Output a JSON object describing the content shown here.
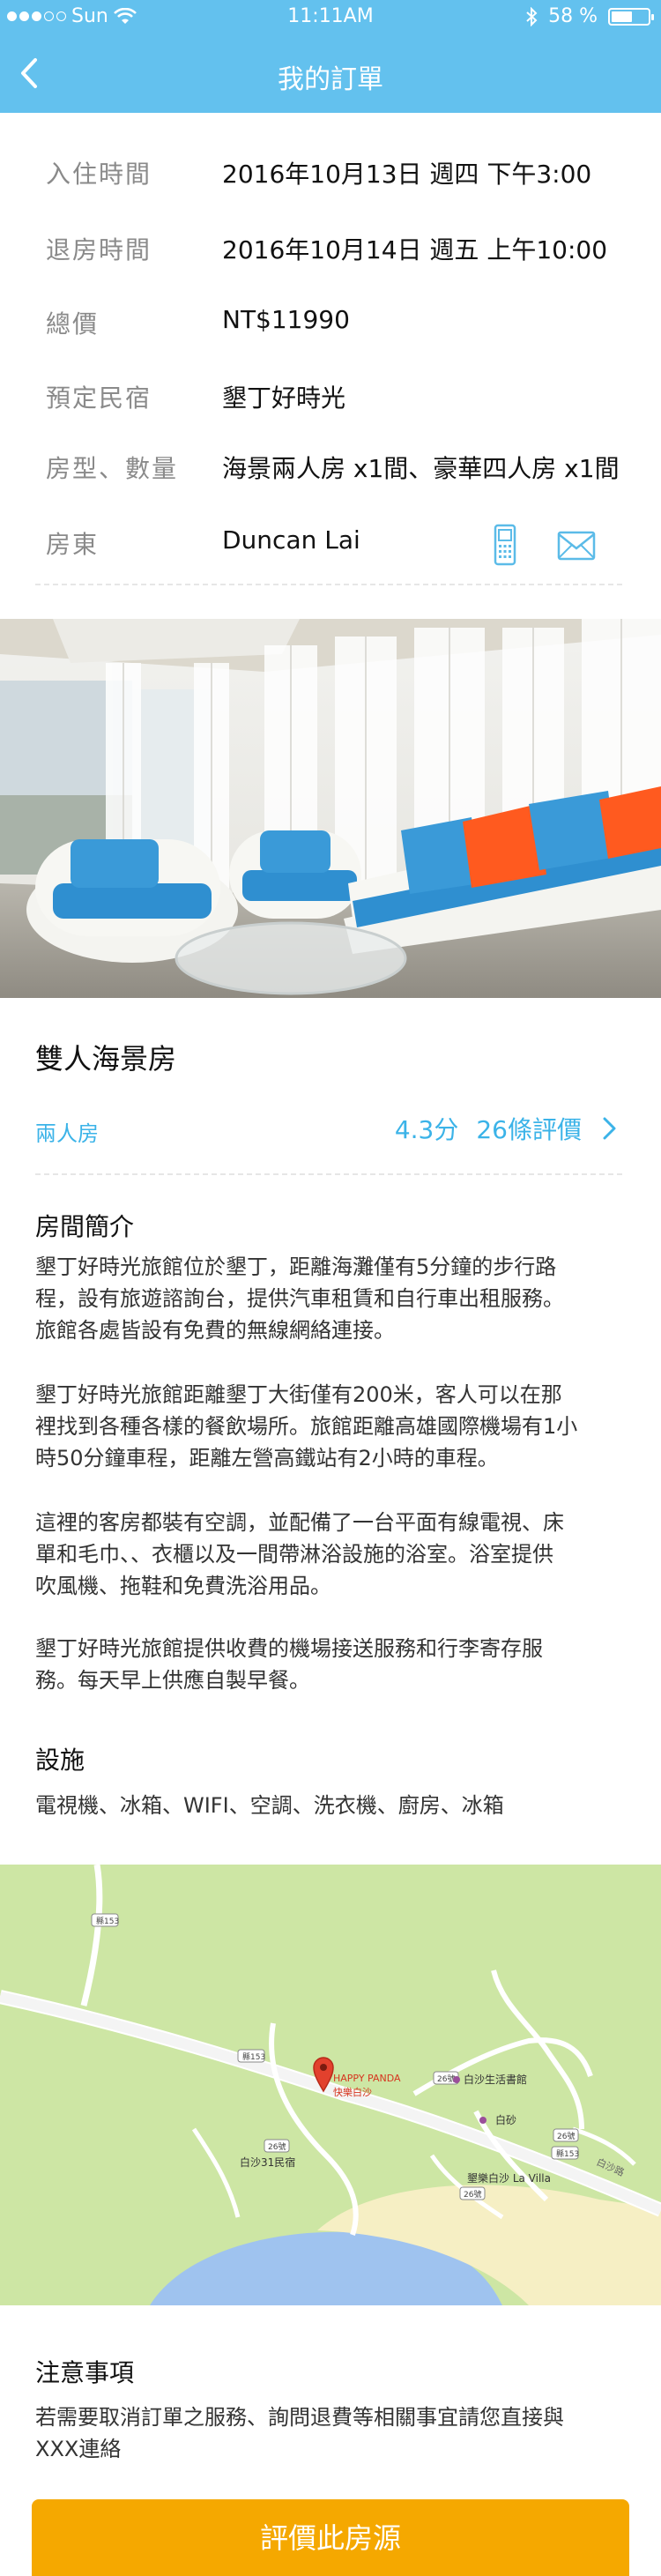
{
  "status_bar": {
    "carrier": "Sun",
    "time": "11:11AM",
    "battery": "58 %",
    "battery_level": 0.58
  },
  "nav": {
    "title": "我的訂單"
  },
  "order": {
    "rows": [
      {
        "label": "入住時間",
        "value": "2016年10月13日 週四 下午3:00"
      },
      {
        "label": "退房時間",
        "value": "2016年10月14日 週五 上午10:00"
      },
      {
        "label": "總價",
        "value": "NT$11990"
      },
      {
        "label": "預定民宿",
        "value": "墾丁好時光"
      },
      {
        "label": "房型、數量",
        "value": "海景兩人房 x1間、豪華四人房 x1間"
      },
      {
        "label": "房東",
        "value": "Duncan Lai"
      }
    ]
  },
  "room": {
    "title": "雙人海景房",
    "type": "兩人房",
    "score": "4.3分",
    "reviews": "26條評價"
  },
  "intro": {
    "title": "房間簡介",
    "paragraphs": [
      [
        "墾丁好時光旅館位於墾丁，距離海灘僅有5分鐘的步行路",
        "程，設有旅遊諮詢台，提供汽車租賃和自行車出租服務。",
        "旅館各處皆設有免費的無線網絡連接。"
      ],
      [
        "墾丁好時光旅館距離墾丁大街僅有200米，客人可以在那",
        "裡找到各種各樣的餐飲場所。旅館距離高雄國際機場有1小",
        "時50分鐘車程，距離左營高鐵站有2小時的車程。"
      ],
      [
        "這裡的客房都裝有空調，並配備了一台平面有線電視、床",
        "單和毛巾、、衣櫃以及一間帶淋浴設施的浴室。浴室提供",
        "吹風機、拖鞋和免費洗浴用品。"
      ],
      [
        "墾丁好時光旅館提供收費的機場接送服務和行李寄存服",
        "務。每天早上供應自製早餐。"
      ]
    ]
  },
  "facilities": {
    "title": "設施",
    "text": "電視機、冰箱、WIFI、空調、洗衣機、廚房、冰箱"
  },
  "map": {
    "pin_en": "HAPPY PANDA",
    "pin_zh": "快樂白沙",
    "road_153": "縣153",
    "road_26": "26號",
    "place_1": "白沙生活書館",
    "place_2": "白砂",
    "place_3": "白沙31民宿",
    "place_4": "墾樂白沙 La Villa",
    "road_label": "白沙路"
  },
  "notice": {
    "title": "注意事項",
    "lines": [
      "若需要取消訂單之服務、詢問退費等相關事宜請您直接與",
      "XXX連絡"
    ]
  },
  "button": {
    "label": "評價此房源"
  },
  "colors": {
    "primary": "#63c1ee",
    "accent": "#3bb3e8",
    "button": "#f5a800"
  }
}
